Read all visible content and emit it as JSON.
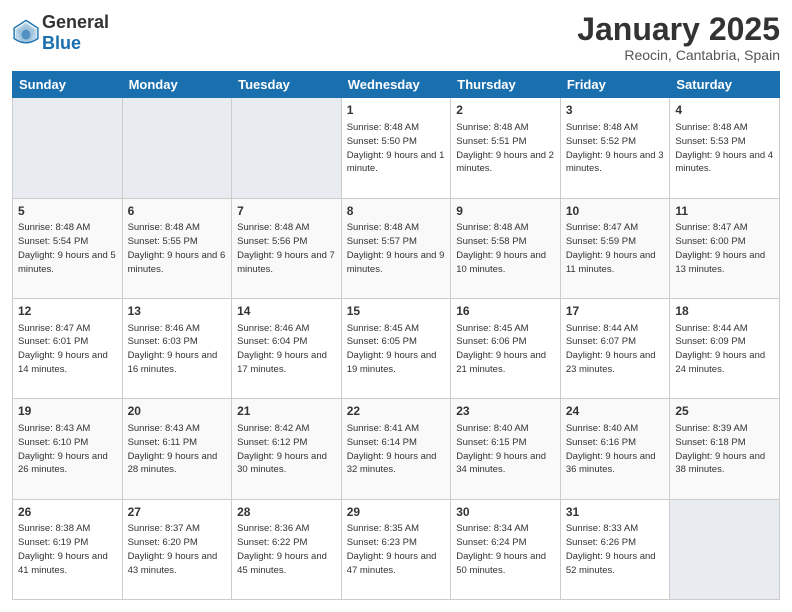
{
  "header": {
    "logo": {
      "general": "General",
      "blue": "Blue"
    },
    "title": "January 2025",
    "subtitle": "Reocin, Cantabria, Spain"
  },
  "calendar": {
    "days_of_week": [
      "Sunday",
      "Monday",
      "Tuesday",
      "Wednesday",
      "Thursday",
      "Friday",
      "Saturday"
    ],
    "weeks": [
      [
        {
          "day": "",
          "empty": true
        },
        {
          "day": "",
          "empty": true
        },
        {
          "day": "",
          "empty": true
        },
        {
          "day": "1",
          "sunrise": "8:48 AM",
          "sunset": "5:50 PM",
          "daylight": "9 hours and 1 minute."
        },
        {
          "day": "2",
          "sunrise": "8:48 AM",
          "sunset": "5:51 PM",
          "daylight": "9 hours and 2 minutes."
        },
        {
          "day": "3",
          "sunrise": "8:48 AM",
          "sunset": "5:52 PM",
          "daylight": "9 hours and 3 minutes."
        },
        {
          "day": "4",
          "sunrise": "8:48 AM",
          "sunset": "5:53 PM",
          "daylight": "9 hours and 4 minutes."
        }
      ],
      [
        {
          "day": "5",
          "sunrise": "8:48 AM",
          "sunset": "5:54 PM",
          "daylight": "9 hours and 5 minutes."
        },
        {
          "day": "6",
          "sunrise": "8:48 AM",
          "sunset": "5:55 PM",
          "daylight": "9 hours and 6 minutes."
        },
        {
          "day": "7",
          "sunrise": "8:48 AM",
          "sunset": "5:56 PM",
          "daylight": "9 hours and 7 minutes."
        },
        {
          "day": "8",
          "sunrise": "8:48 AM",
          "sunset": "5:57 PM",
          "daylight": "9 hours and 9 minutes."
        },
        {
          "day": "9",
          "sunrise": "8:48 AM",
          "sunset": "5:58 PM",
          "daylight": "9 hours and 10 minutes."
        },
        {
          "day": "10",
          "sunrise": "8:47 AM",
          "sunset": "5:59 PM",
          "daylight": "9 hours and 11 minutes."
        },
        {
          "day": "11",
          "sunrise": "8:47 AM",
          "sunset": "6:00 PM",
          "daylight": "9 hours and 13 minutes."
        }
      ],
      [
        {
          "day": "12",
          "sunrise": "8:47 AM",
          "sunset": "6:01 PM",
          "daylight": "9 hours and 14 minutes."
        },
        {
          "day": "13",
          "sunrise": "8:46 AM",
          "sunset": "6:03 PM",
          "daylight": "9 hours and 16 minutes."
        },
        {
          "day": "14",
          "sunrise": "8:46 AM",
          "sunset": "6:04 PM",
          "daylight": "9 hours and 17 minutes."
        },
        {
          "day": "15",
          "sunrise": "8:45 AM",
          "sunset": "6:05 PM",
          "daylight": "9 hours and 19 minutes."
        },
        {
          "day": "16",
          "sunrise": "8:45 AM",
          "sunset": "6:06 PM",
          "daylight": "9 hours and 21 minutes."
        },
        {
          "day": "17",
          "sunrise": "8:44 AM",
          "sunset": "6:07 PM",
          "daylight": "9 hours and 23 minutes."
        },
        {
          "day": "18",
          "sunrise": "8:44 AM",
          "sunset": "6:09 PM",
          "daylight": "9 hours and 24 minutes."
        }
      ],
      [
        {
          "day": "19",
          "sunrise": "8:43 AM",
          "sunset": "6:10 PM",
          "daylight": "9 hours and 26 minutes."
        },
        {
          "day": "20",
          "sunrise": "8:43 AM",
          "sunset": "6:11 PM",
          "daylight": "9 hours and 28 minutes."
        },
        {
          "day": "21",
          "sunrise": "8:42 AM",
          "sunset": "6:12 PM",
          "daylight": "9 hours and 30 minutes."
        },
        {
          "day": "22",
          "sunrise": "8:41 AM",
          "sunset": "6:14 PM",
          "daylight": "9 hours and 32 minutes."
        },
        {
          "day": "23",
          "sunrise": "8:40 AM",
          "sunset": "6:15 PM",
          "daylight": "9 hours and 34 minutes."
        },
        {
          "day": "24",
          "sunrise": "8:40 AM",
          "sunset": "6:16 PM",
          "daylight": "9 hours and 36 minutes."
        },
        {
          "day": "25",
          "sunrise": "8:39 AM",
          "sunset": "6:18 PM",
          "daylight": "9 hours and 38 minutes."
        }
      ],
      [
        {
          "day": "26",
          "sunrise": "8:38 AM",
          "sunset": "6:19 PM",
          "daylight": "9 hours and 41 minutes."
        },
        {
          "day": "27",
          "sunrise": "8:37 AM",
          "sunset": "6:20 PM",
          "daylight": "9 hours and 43 minutes."
        },
        {
          "day": "28",
          "sunrise": "8:36 AM",
          "sunset": "6:22 PM",
          "daylight": "9 hours and 45 minutes."
        },
        {
          "day": "29",
          "sunrise": "8:35 AM",
          "sunset": "6:23 PM",
          "daylight": "9 hours and 47 minutes."
        },
        {
          "day": "30",
          "sunrise": "8:34 AM",
          "sunset": "6:24 PM",
          "daylight": "9 hours and 50 minutes."
        },
        {
          "day": "31",
          "sunrise": "8:33 AM",
          "sunset": "6:26 PM",
          "daylight": "9 hours and 52 minutes."
        },
        {
          "day": "",
          "empty": true
        }
      ]
    ]
  }
}
